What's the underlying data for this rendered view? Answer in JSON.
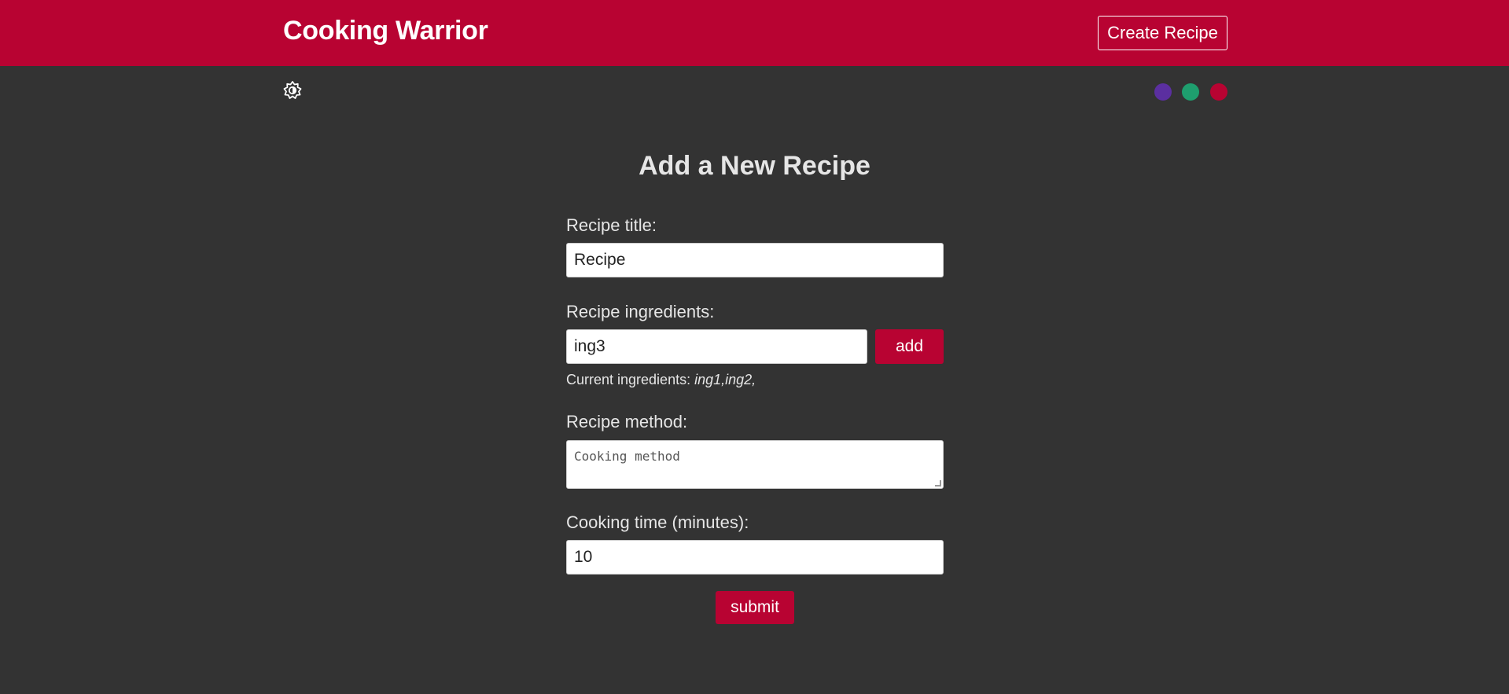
{
  "header": {
    "brand": "Cooking Warrior",
    "create_button": "Create Recipe",
    "background_color": "#b80332"
  },
  "toolbar": {
    "mode_toggle_icon": "brightness-icon",
    "theme_dots": [
      {
        "name": "purple",
        "color": "#5b2fa0"
      },
      {
        "name": "green",
        "color": "#1e9e6e"
      },
      {
        "name": "red",
        "color": "#b80332"
      }
    ]
  },
  "form": {
    "title": "Add a New Recipe",
    "title_label": "Recipe title:",
    "title_value": "Recipe",
    "ingredients_label": "Recipe ingredients:",
    "ingredient_value": "ing3",
    "add_button": "add",
    "current_ingredients_prefix": "Current ingredients:",
    "current_ingredients": "ing1,ing2,",
    "method_label": "Recipe method:",
    "method_value": "Cooking method",
    "time_label": "Cooking time (minutes):",
    "time_value": "10",
    "submit_button": "submit"
  }
}
